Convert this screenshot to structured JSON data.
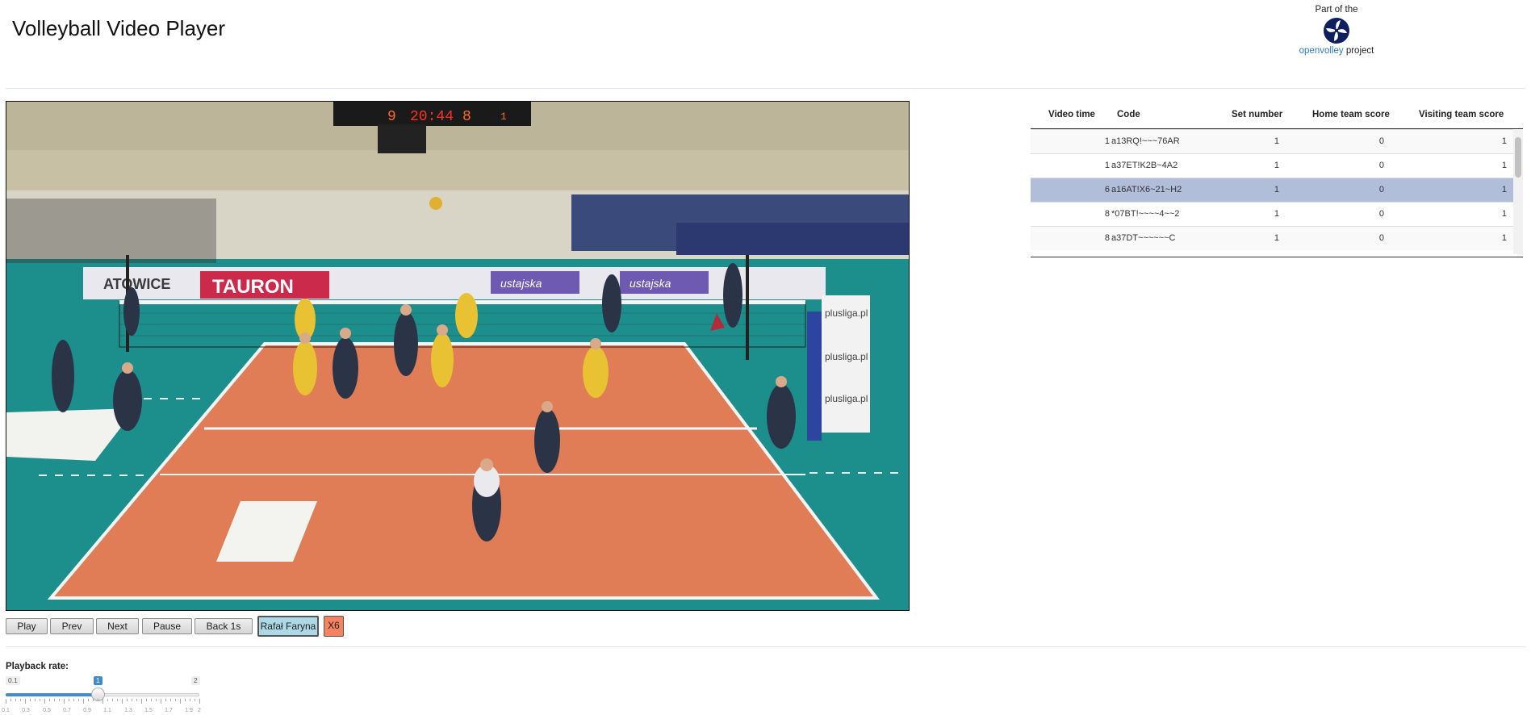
{
  "app": {
    "title": "Volleyball Video Player",
    "logo": {
      "line1": "Part of the",
      "link_text": "openvolley",
      "suffix": " project"
    }
  },
  "video": {
    "scoreboard": {
      "home_score": "9",
      "clock": "20:44",
      "visitor_score": "8",
      "set": "1"
    },
    "banners": [
      "TAURON",
      "ATOWICE",
      "plusliga.pl",
      "plusliga.pl",
      "plusliga.pl",
      "ustajska",
      "ustajska"
    ]
  },
  "controls": {
    "buttons": [
      "Play",
      "Prev",
      "Next",
      "Pause",
      "Back 1s"
    ],
    "player_chip": "Rafał Faryna",
    "skill_chip": "X6",
    "colors": {
      "player_chip_bg": "#add8e6",
      "skill_chip_bg": "#f4845f"
    }
  },
  "playback": {
    "label": "Playback rate:",
    "min_label": "0.1",
    "max_label": "2",
    "value_label": "1",
    "min": 0.1,
    "max": 2,
    "value": 1,
    "tick_labels": [
      "0.1",
      "0.3",
      "0.5",
      "0.7",
      "0.9",
      "1.1",
      "1.3",
      "1.5",
      "1.7",
      "1.9",
      "2"
    ],
    "accent": "#428bca"
  },
  "table": {
    "columns": [
      "Video time",
      "Code",
      "Set number",
      "Home team score",
      "Visiting team score"
    ],
    "rows": [
      {
        "video_time": "1",
        "code": "a13RQ!~~~76AR",
        "set": "1",
        "home": "0",
        "visiting": "1",
        "selected": false
      },
      {
        "video_time": "1",
        "code": "a37ET!K2B~4A2",
        "set": "1",
        "home": "0",
        "visiting": "1",
        "selected": false
      },
      {
        "video_time": "6",
        "code": "a16AT!X6~21~H2",
        "set": "1",
        "home": "0",
        "visiting": "1",
        "selected": true
      },
      {
        "video_time": "8",
        "code": "*07BT!~~~~4~~2",
        "set": "1",
        "home": "0",
        "visiting": "1",
        "selected": false
      },
      {
        "video_time": "8",
        "code": "a37DT~~~~~~C",
        "set": "1",
        "home": "0",
        "visiting": "1",
        "selected": false
      }
    ],
    "selected_color": "#b0bed9"
  }
}
